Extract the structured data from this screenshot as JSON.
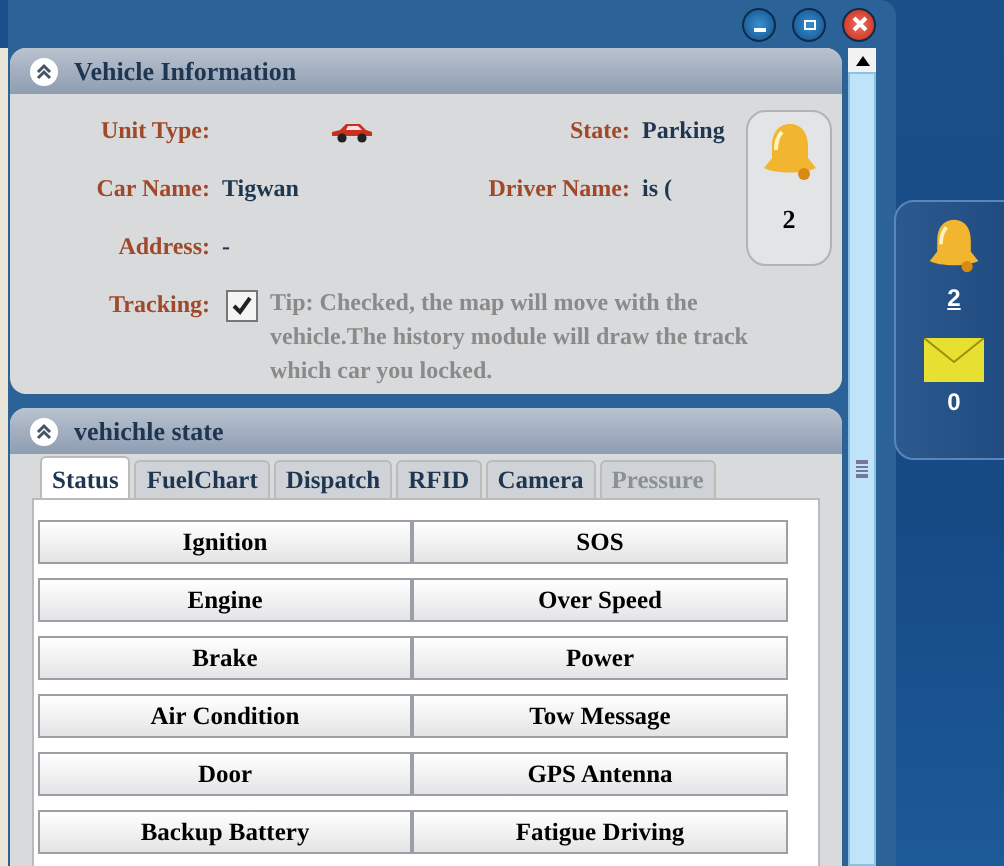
{
  "vehicle_info": {
    "title": "Vehicle Information",
    "unit_type": {
      "label": "Unit Type:"
    },
    "state": {
      "label": "State:",
      "value": "Parking"
    },
    "car_name": {
      "label": "Car Name:",
      "value": "Tigwan"
    },
    "driver_name": {
      "label": "Driver Name:",
      "value": "is ("
    },
    "address": {
      "label": "Address:",
      "value": "-"
    },
    "tracking": {
      "label": "Tracking:",
      "checked": true,
      "tip": "Tip: Checked, the map will move with the vehicle.The history module will draw the track which car you locked."
    },
    "alarm_popup": {
      "count": "2"
    }
  },
  "vehicle_state": {
    "title": "vehichle state",
    "tabs": [
      {
        "label": "Status",
        "selected": true,
        "disabled": false
      },
      {
        "label": "FuelChart",
        "selected": false,
        "disabled": false
      },
      {
        "label": "Dispatch",
        "selected": false,
        "disabled": false
      },
      {
        "label": "RFID",
        "selected": false,
        "disabled": false
      },
      {
        "label": "Camera",
        "selected": false,
        "disabled": false
      },
      {
        "label": "Pressure",
        "selected": false,
        "disabled": true
      }
    ],
    "status_items": [
      "Ignition",
      "SOS",
      "Engine",
      "Over Speed",
      "Brake",
      "Power",
      "Air Condition",
      "Tow Message",
      "Door",
      "GPS Antenna",
      "Backup Battery",
      "Fatigue Driving"
    ]
  },
  "side_panel": {
    "alarm_count": "2",
    "message_count": "0"
  }
}
